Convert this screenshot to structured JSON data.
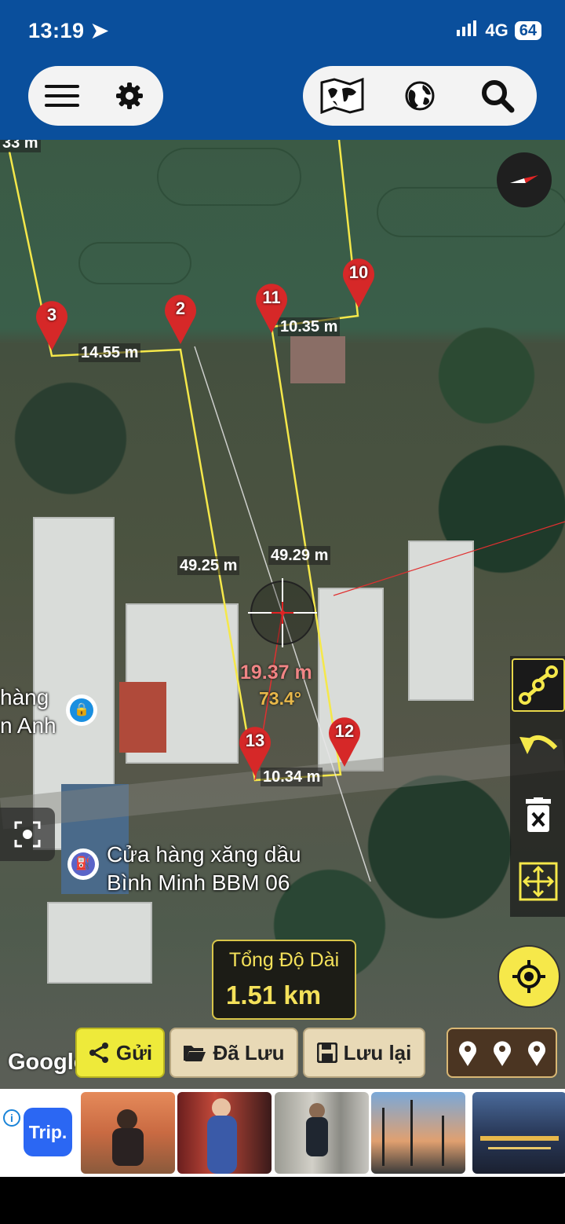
{
  "status": {
    "time": "13:19",
    "network": "4G",
    "battery": "64"
  },
  "toolbar": {
    "left": [
      {
        "icon": "menu-icon"
      },
      {
        "icon": "gear-icon"
      }
    ],
    "right": [
      {
        "icon": "world-map-icon"
      },
      {
        "icon": "globe-icon"
      },
      {
        "icon": "search-icon"
      }
    ]
  },
  "map": {
    "top_cut_label": "33 m",
    "pins": [
      {
        "label": "3"
      },
      {
        "label": "2"
      },
      {
        "label": "11"
      },
      {
        "label": "10"
      },
      {
        "label": "13"
      },
      {
        "label": "12"
      }
    ],
    "distances": {
      "d_3_2": "14.55 m",
      "d_11_10": "10.35 m",
      "d_left": "49.25 m",
      "d_right": "49.29 m",
      "d_13_12": "10.34 m"
    },
    "cursor": {
      "distance": "19.37 m",
      "angle": "73.4°"
    },
    "poi1": {
      "line1": "hàng",
      "line2": "n Anh"
    },
    "poi2": {
      "line1": "Cửa hàng xăng dầu",
      "line2": "Bình Minh BBM 06"
    },
    "google": "Google"
  },
  "total": {
    "label": "Tổng Độ Dài",
    "value": "1.51 km"
  },
  "buttons": {
    "send": "Gửi",
    "saved": "Đã Lưu",
    "save": "Lưu lại"
  },
  "colors": {
    "header": "#0a4f9c",
    "line": "#f5e84a",
    "pin": "#d62828",
    "accent": "#eeea3a"
  },
  "ad": {
    "brand": "Trip."
  }
}
